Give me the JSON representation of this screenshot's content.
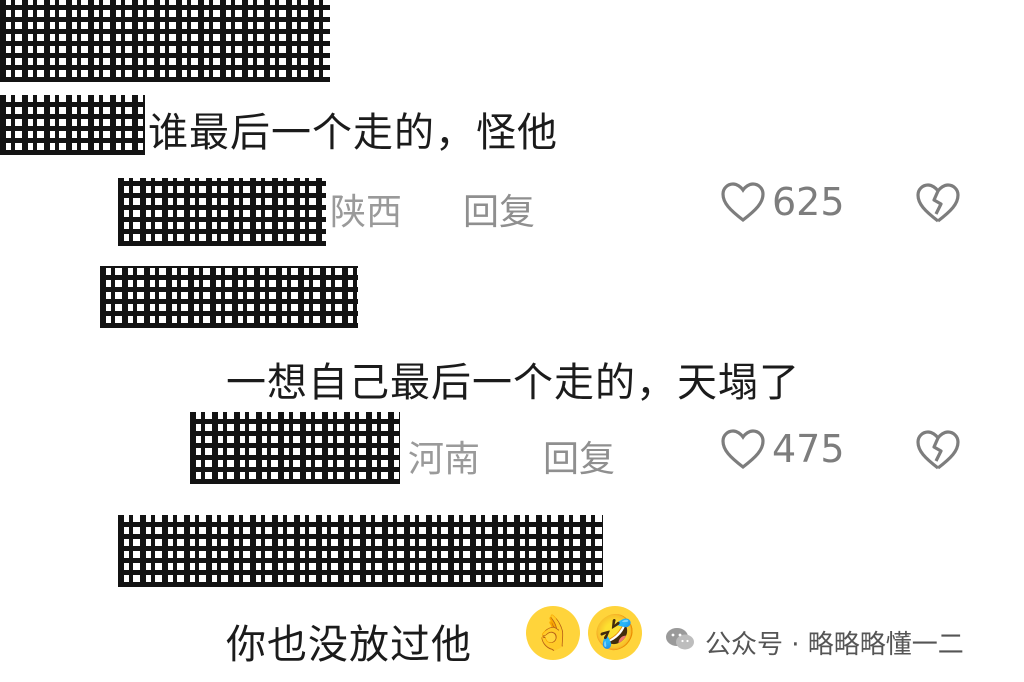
{
  "comments": [
    {
      "text": "谁最后一个走的，怪他",
      "location": "陕西",
      "reply_label": "回复",
      "likes": "625"
    },
    {
      "text": "一想自己最后一个走的，天塌了",
      "location": "河南",
      "reply_label": "回复",
      "likes": "475"
    },
    {
      "text": "你也没放过他",
      "emojis": [
        "ok-hand-emoji",
        "laughing-tears-emoji"
      ]
    }
  ],
  "watermark": {
    "text": "公众号 · 略略略懂一二"
  },
  "icons": {
    "like": "heart-outline-icon",
    "dislike": "broken-heart-icon",
    "watermark": "wechat-icon"
  },
  "colors": {
    "text": "#1b1b1b",
    "meta": "#9a9a9a",
    "icon": "#7d7d7d"
  }
}
